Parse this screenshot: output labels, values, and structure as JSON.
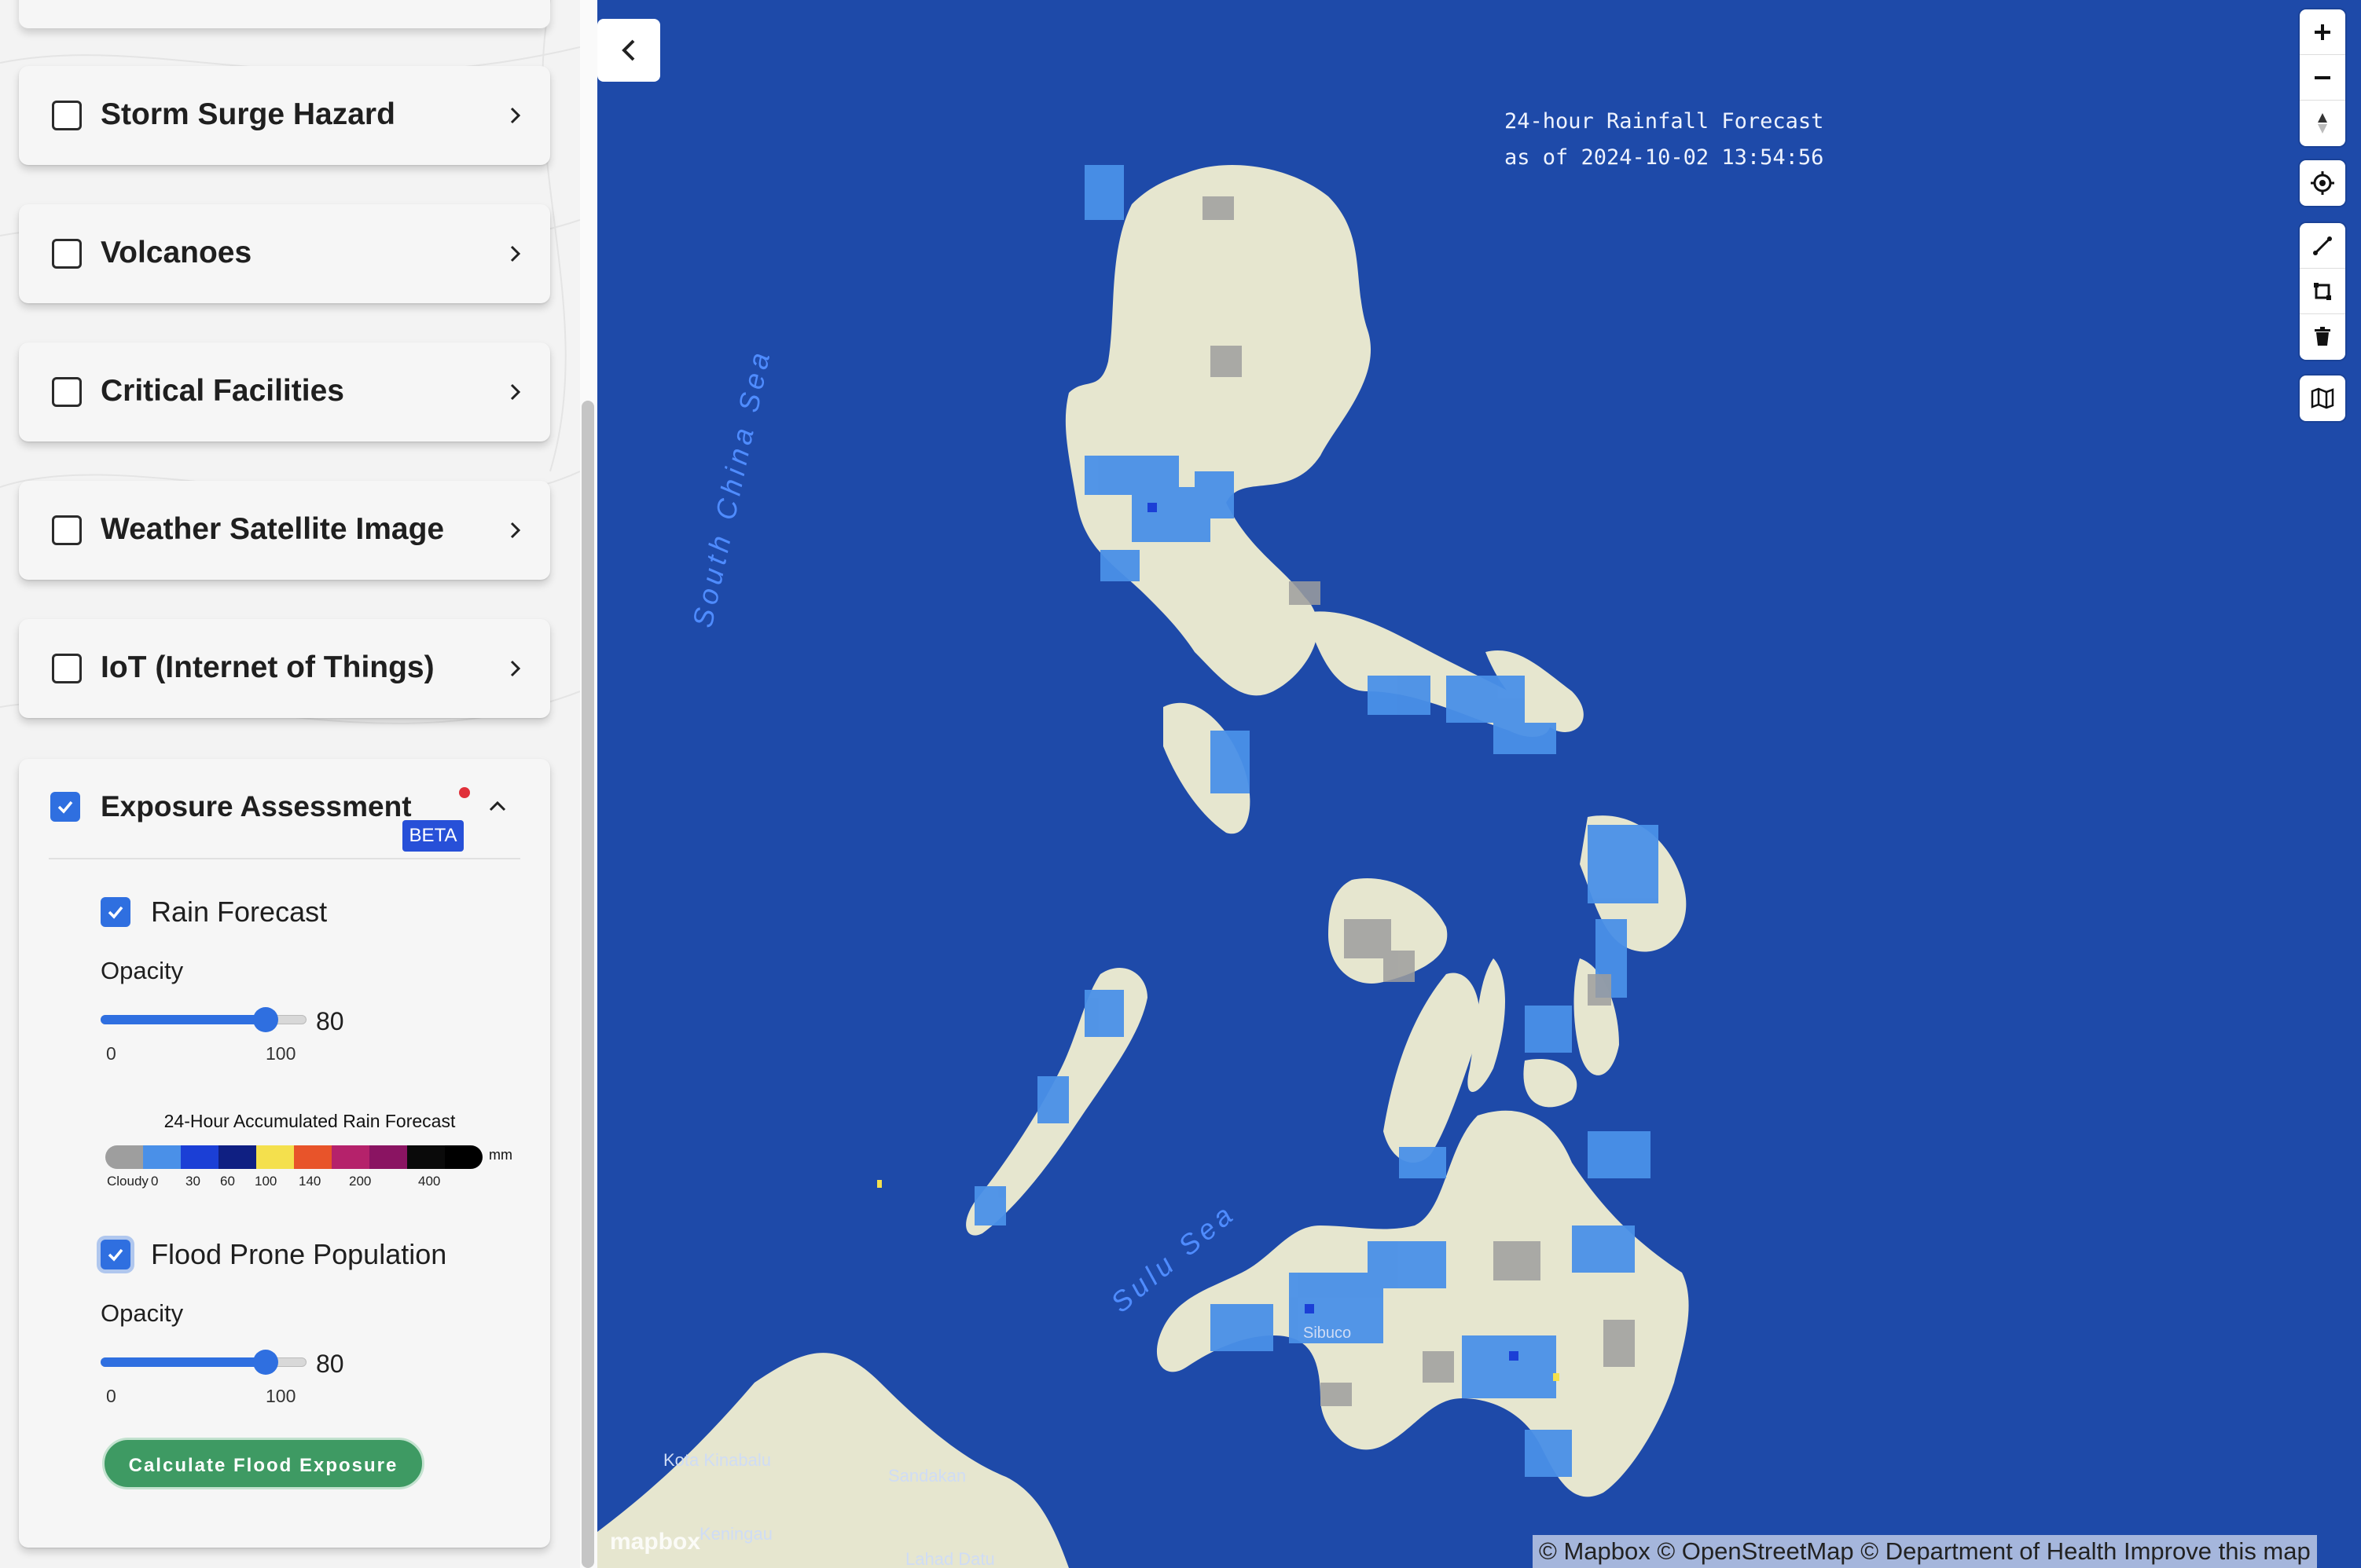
{
  "sidebar": {
    "layers": [
      {
        "label": "Storm Surge Hazard",
        "checked": false
      },
      {
        "label": "Volcanoes",
        "checked": false
      },
      {
        "label": "Critical Facilities",
        "checked": false
      },
      {
        "label": "Weather Satellite Image",
        "checked": false
      },
      {
        "label": "IoT (Internet of Things)",
        "checked": false
      }
    ],
    "exposure": {
      "label": "Exposure Assessment",
      "badge": "BETA",
      "checked": true,
      "rain": {
        "label": "Rain Forecast",
        "checked": true,
        "opacity_label": "Opacity",
        "opacity_value": "80",
        "min": "0",
        "max": "100",
        "legend_title": "24-Hour Accumulated Rain Forecast",
        "legend_unit": "mm",
        "legend_colors": [
          "#9e9e9e",
          "#4a90e8",
          "#1b3fd6",
          "#0f1f82",
          "#f4e04d",
          "#e8542a",
          "#b5226b",
          "#8a1462",
          "#0a0a0a",
          "#000000"
        ],
        "legend_ticks": [
          "Cloudy",
          "0",
          "30",
          "60",
          "100",
          "140",
          "200",
          "400"
        ]
      },
      "flood": {
        "label": "Flood Prone Population",
        "checked": true,
        "opacity_label": "Opacity",
        "opacity_value": "80",
        "min": "0",
        "max": "100"
      },
      "button_label": "Calculate Flood Exposure"
    }
  },
  "map": {
    "forecast_line1": "24-hour Rainfall Forecast",
    "forecast_line2": "as of 2024-10-02 13:54:56",
    "sea_labels": {
      "south_china": "South China Sea",
      "sulu": "Sulu Sea"
    },
    "place_labels": {
      "kota": "Kota Kinabalu",
      "sandakan": "Sandakan",
      "keningau": "Keningau",
      "lahad": "Lahad Datu",
      "sibuco": "Sibuco"
    },
    "attribution": "© Mapbox © OpenStreetMap © Department of Health Improve this map",
    "logo": "mapbox",
    "colors": {
      "sea": "#1e4aa9",
      "land": "#e6e6cf",
      "rain_light": "#4a90e8",
      "cloudy": "#9e9e9e"
    },
    "controls": [
      "zoom-in",
      "zoom-out",
      "compass",
      "geolocate",
      "draw-line",
      "draw-polygon",
      "trash",
      "map-style"
    ]
  }
}
